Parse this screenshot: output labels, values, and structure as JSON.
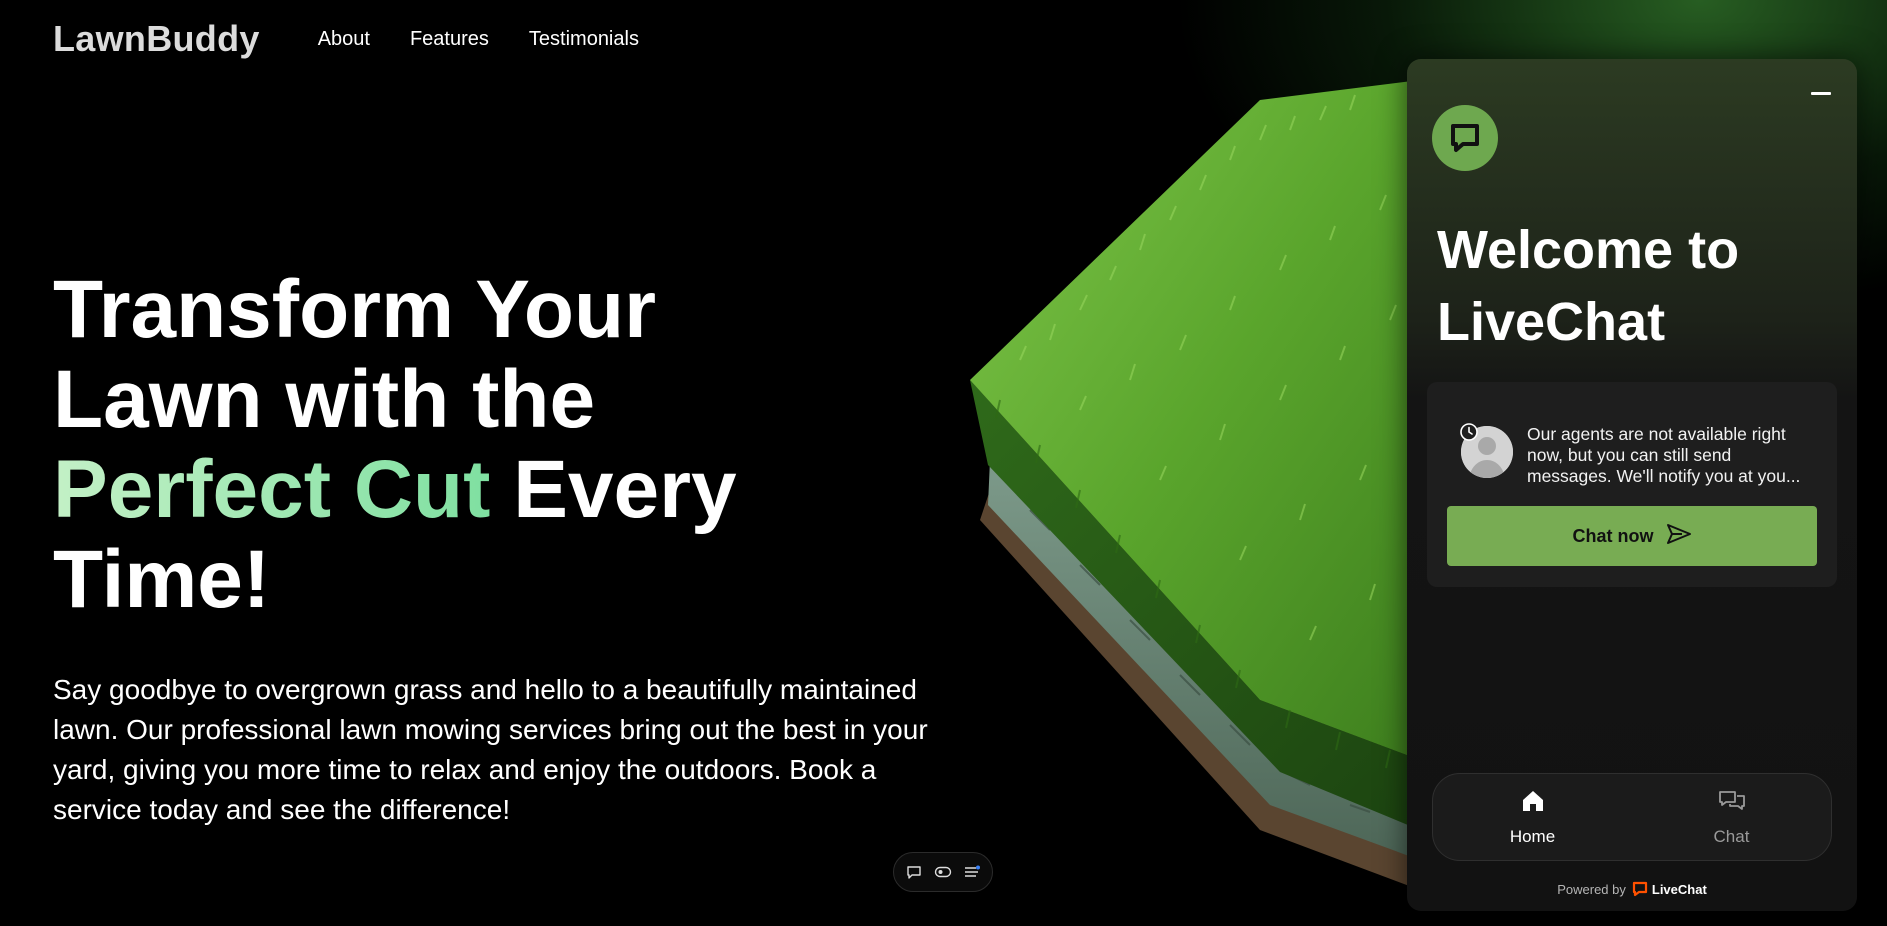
{
  "brand": {
    "logo": "LawnBuddy"
  },
  "nav": {
    "items": [
      {
        "label": "About"
      },
      {
        "label": "Features"
      },
      {
        "label": "Testimonials"
      }
    ]
  },
  "hero": {
    "title_line1": "Transform Your",
    "title_line2": "Lawn with the",
    "title_highlight": "Perfect Cut",
    "title_rest": " Every",
    "title_line4": "Time!",
    "subtitle": "Say goodbye to overgrown grass and hello to a beautifully maintained lawn. Our professional lawn mowing services bring out the best in your yard, giving you more time to relax and enjoy the outdoors. Book a service today and see the difference!",
    "highlight_colors": [
      "#c3f0c6",
      "#7fe0a1"
    ]
  },
  "mini_toolbar": {
    "icons": [
      "chat-bubble-icon",
      "toggle-icon",
      "menu-icon"
    ]
  },
  "chat_widget": {
    "welcome_line1": "Welcome to",
    "welcome_line2": "LiveChat",
    "agent_message": "Our agents are not available right now, but you can still send messages. We'll notify you at you...",
    "chat_now_label": "Chat now",
    "tabs": [
      {
        "label": "Home",
        "icon": "home-icon",
        "active": true
      },
      {
        "label": "Chat",
        "icon": "chat-icon",
        "active": false
      }
    ],
    "footer_powered": "Powered by",
    "footer_brand": "LiveChat",
    "accent_color": "#78ac53",
    "brand_color": "#ff5100"
  }
}
